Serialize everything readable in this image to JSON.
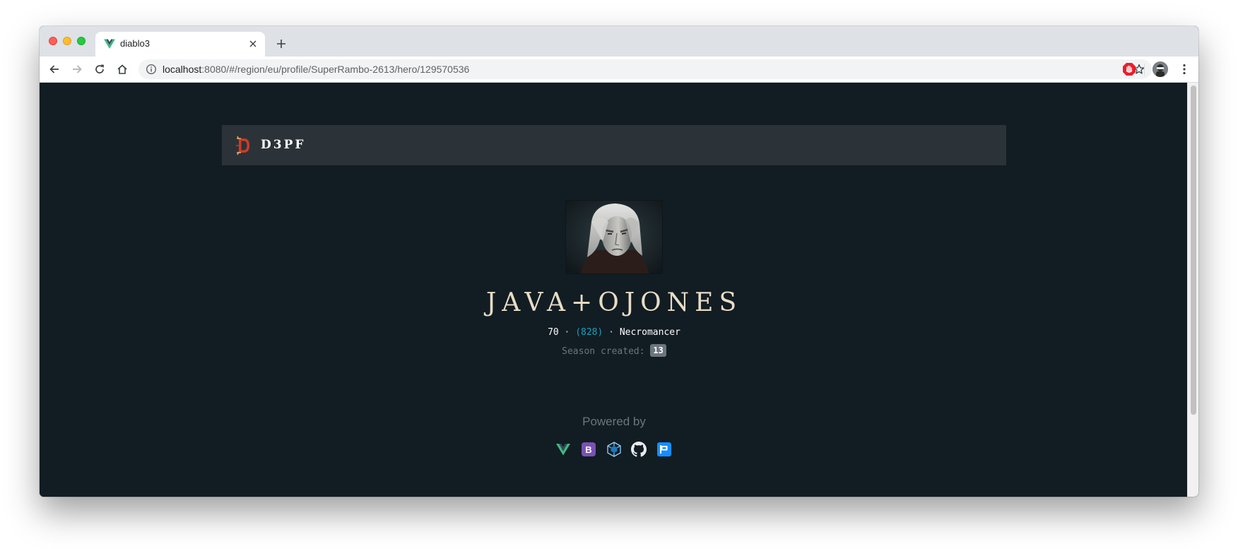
{
  "browser": {
    "tab": {
      "title": "diablo3",
      "favicon": "vue-icon"
    },
    "url_host": "localhost",
    "url_path": ":8080/#/region/eu/profile/SuperRambo-2613/hero/129570536"
  },
  "navbar": {
    "brand": "D3PF",
    "logo": "diablo-d-icon"
  },
  "hero": {
    "name": "JAVA+OJONES",
    "level": "70",
    "paragon": "(828)",
    "class": "Necromancer",
    "separator": "·",
    "season_label": "Season created:",
    "season_value": "13"
  },
  "footer": {
    "powered_by": "Powered by",
    "icons": [
      "vue-icon",
      "bootstrap-icon",
      "webpack-icon",
      "github-icon",
      "blizzard-api-icon"
    ]
  },
  "colors": {
    "page_bg": "#121c23",
    "navbar_bg": "#2b3339",
    "hero_name": "#e8dcc6",
    "paragon": "#17a2b8",
    "muted": "#6c757d",
    "vue_green": "#41b883",
    "bootstrap_purple": "#7952b3",
    "webpack_blue": "#1c78c0",
    "blizzard_blue": "#148eff"
  }
}
